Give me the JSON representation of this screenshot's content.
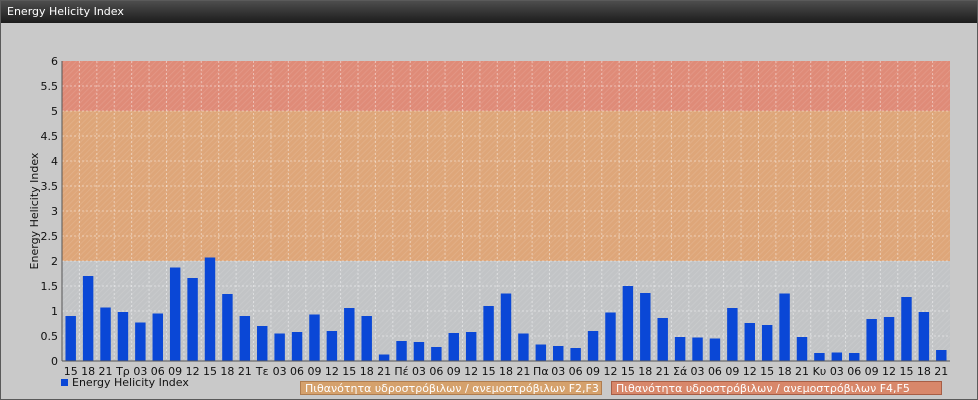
{
  "window": {
    "title": "Energy Helicity Index"
  },
  "chart_data": {
    "type": "bar",
    "ylabel": "Energy Helicity Index",
    "ylim": [
      0,
      6
    ],
    "yticks": [
      "0",
      "0.5",
      "1",
      "1.5",
      "2",
      "2.5",
      "3",
      "3.5",
      "4",
      "4.5",
      "5",
      "5.5",
      "6"
    ],
    "grid": true,
    "categories": [
      "15",
      "18",
      "21",
      "Τρ",
      "03",
      "06",
      "09",
      "12",
      "15",
      "18",
      "21",
      "Τε",
      "03",
      "06",
      "09",
      "12",
      "15",
      "18",
      "21",
      "Πέ",
      "03",
      "06",
      "09",
      "12",
      "15",
      "18",
      "21",
      "Πα",
      "03",
      "06",
      "09",
      "12",
      "15",
      "18",
      "21",
      "Σά",
      "03",
      "06",
      "09",
      "12",
      "15",
      "18",
      "21",
      "Κυ",
      "03",
      "06",
      "09",
      "12",
      "15",
      "18",
      "21"
    ],
    "series": [
      {
        "name": "Energy Helicity Index",
        "values": [
          0.9,
          1.7,
          1.07,
          0.98,
          0.77,
          0.95,
          1.87,
          1.66,
          2.07,
          1.34,
          0.9,
          0.7,
          0.55,
          0.58,
          0.93,
          0.6,
          1.06,
          0.9,
          0.13,
          0.4,
          0.38,
          0.28,
          0.56,
          0.58,
          1.1,
          1.35,
          0.55,
          0.33,
          0.3,
          0.26,
          0.6,
          0.97,
          1.5,
          1.36,
          0.86,
          0.48,
          0.47,
          0.45,
          1.06,
          0.76,
          0.72,
          1.35,
          0.48,
          0.16,
          0.17,
          0.16,
          0.84,
          0.88,
          1.28,
          0.98,
          0.22
        ]
      }
    ],
    "bands": [
      {
        "from": 0,
        "to": 2,
        "color": "#c2c4c6"
      },
      {
        "from": 2,
        "to": 5,
        "color": "#dea679",
        "label": "Πιθανότητα υδροστρόβιλων / ανεμοστρόβιλων F2,F3"
      },
      {
        "from": 5,
        "to": 6,
        "color": "#df8b78",
        "label": "Πιθανότητα υδροστρόβιλων / ανεμοστρόβιλων F4,F5"
      }
    ],
    "bar_color": "#0a47d6",
    "legend": {
      "position": "bottom-left",
      "label": "Energy Helicity Index"
    }
  }
}
